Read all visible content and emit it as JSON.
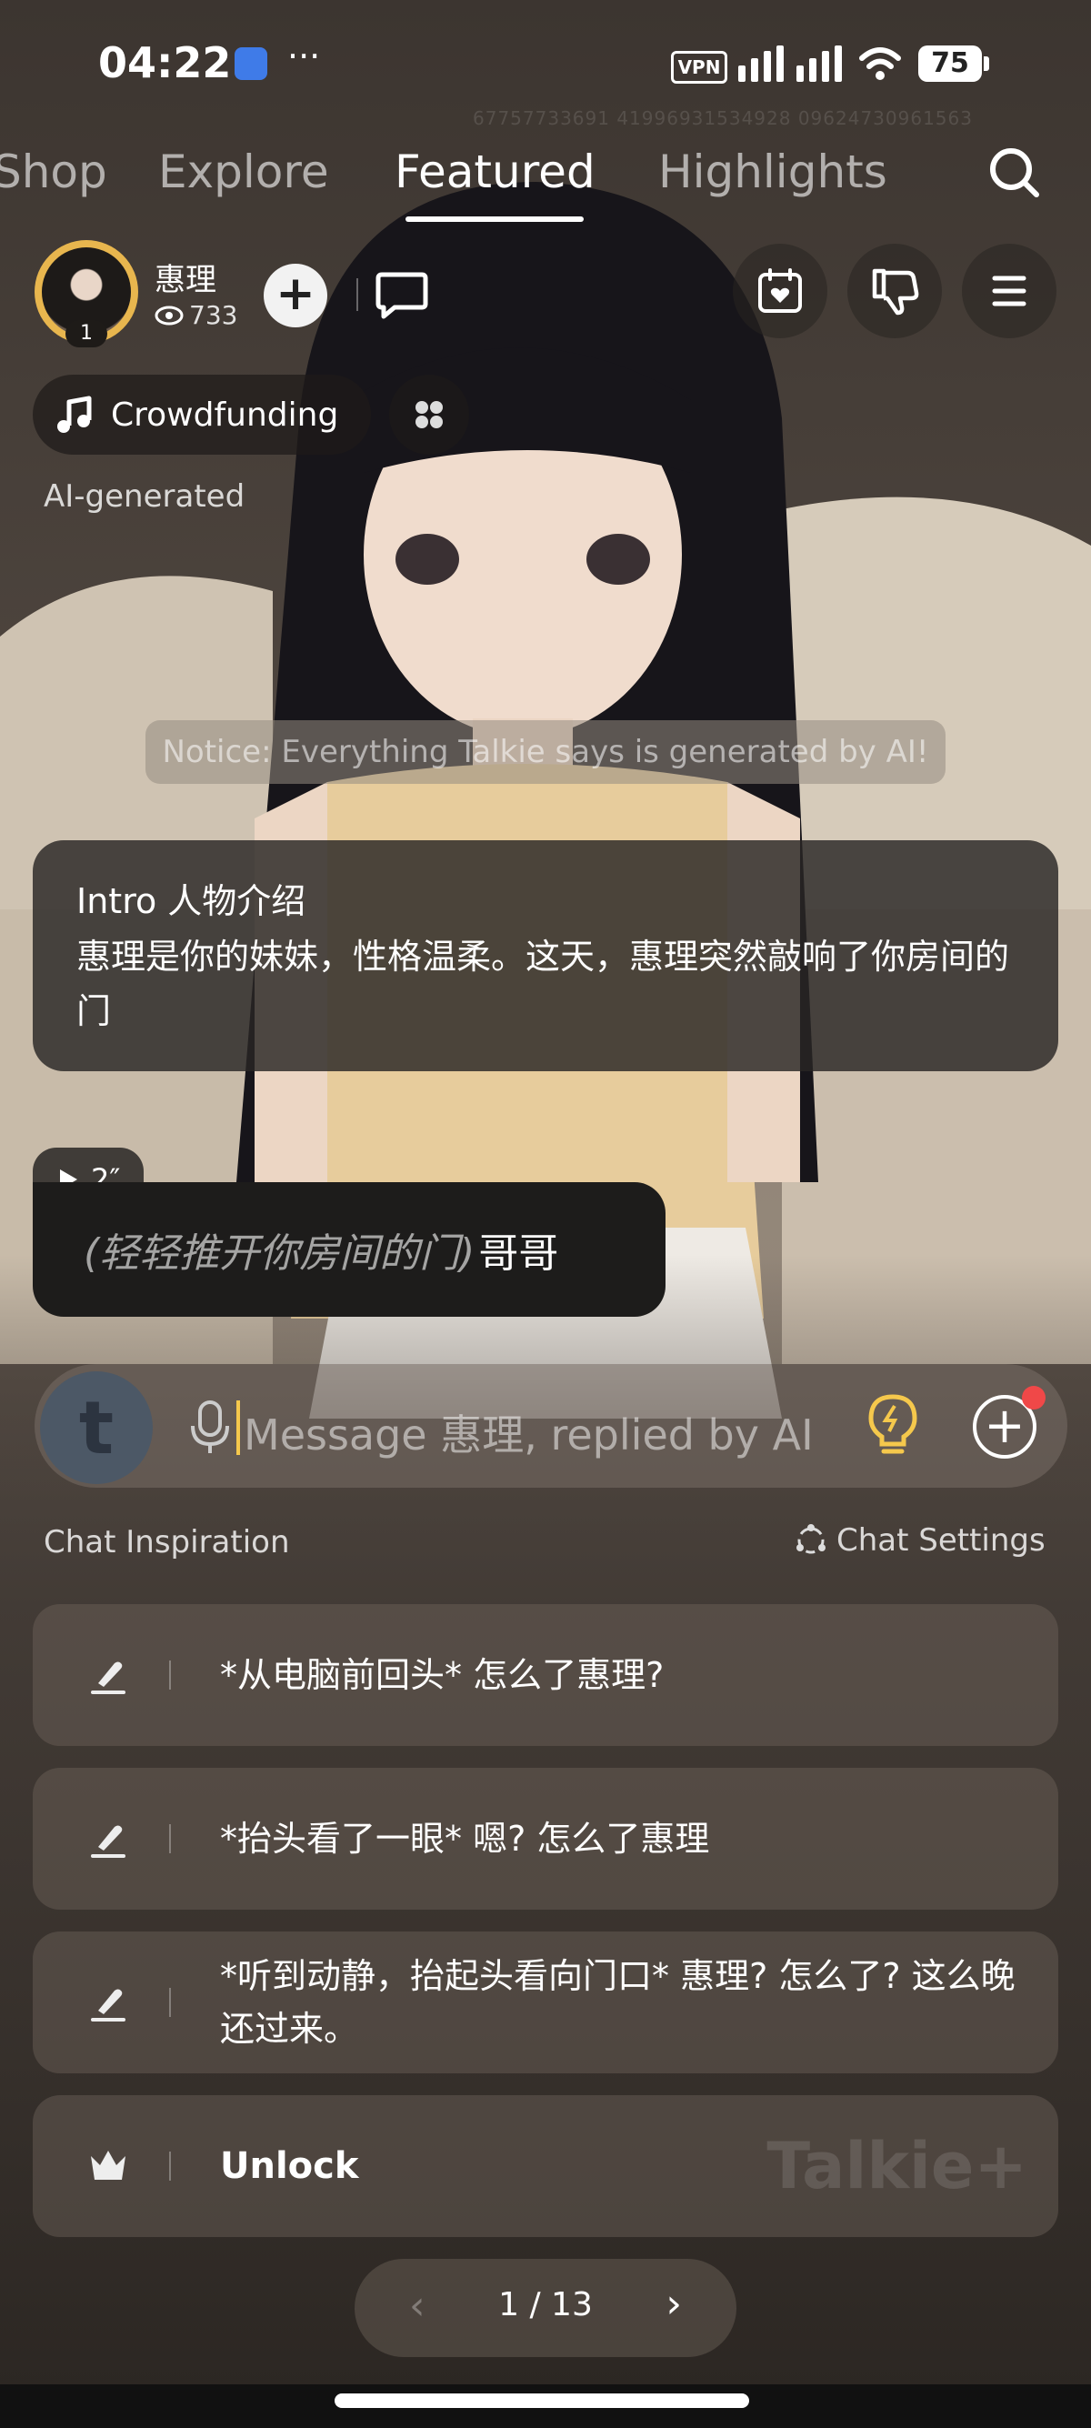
{
  "status_bar": {
    "time": "04:22",
    "more": "···",
    "vpn": "VPN",
    "battery": "75"
  },
  "watermark": "67757733691  41996931534928  09624730961563",
  "tabs": [
    {
      "label": "Shop",
      "active": false
    },
    {
      "label": "Explore",
      "active": false
    },
    {
      "label": "Featured",
      "active": true
    },
    {
      "label": "Highlights",
      "active": false
    }
  ],
  "profile": {
    "name": "惠理",
    "views": "733",
    "level": "1"
  },
  "crowdfunding_label": "Crowdfunding",
  "ai_generated_label": "AI-generated",
  "notice": "Notice: Everything Talkie says is generated by AI!",
  "intro": {
    "title": "Intro 人物介绍",
    "body": "惠理是你的妹妹，性格温柔。这天，惠理突然敲响了你房间的门"
  },
  "message": {
    "voice_duration": "2″",
    "action": "(轻轻推开你房间的门)",
    "text": "哥哥"
  },
  "input": {
    "placeholder": "Message 惠理, replied by AI"
  },
  "chat_inspiration_label": "Chat Inspiration",
  "chat_settings_label": "Chat Settings",
  "suggestions": [
    {
      "text": "*从电脑前回头* 怎么了惠理?"
    },
    {
      "text": "*抬头看了一眼* 嗯? 怎么了惠理"
    },
    {
      "text": "*听到动静，抬起头看向门口* 惠理? 怎么了? 这么晚还过来。"
    }
  ],
  "unlock": {
    "label": "Unlock",
    "badge": "Talkie+"
  },
  "pager": {
    "text": "1 / 13",
    "prev": "‹",
    "next": "›"
  },
  "colors": {
    "accent": "#f5c84c",
    "ring": "#e8b64e",
    "notification": "#f04848"
  }
}
